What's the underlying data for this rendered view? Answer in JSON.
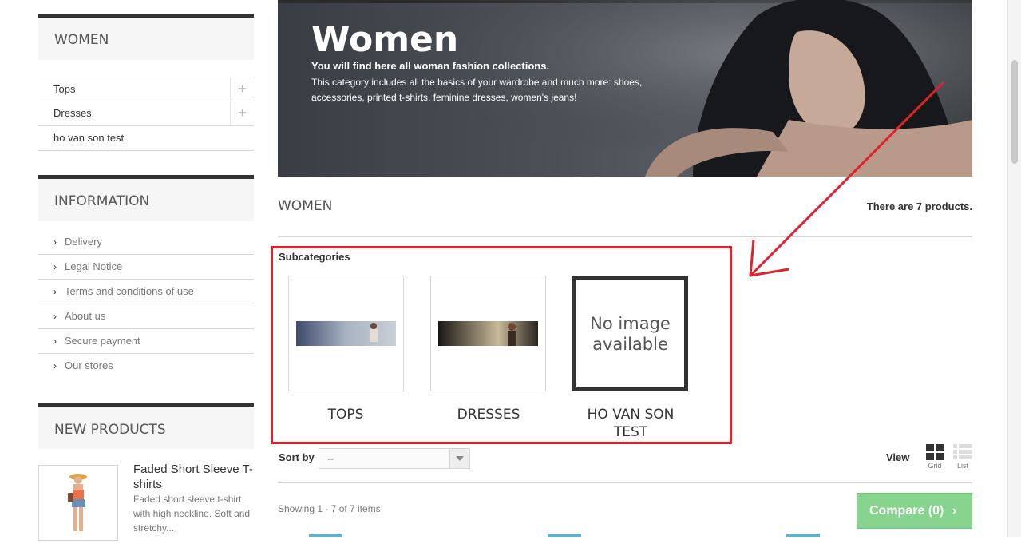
{
  "sidebar": {
    "categories": {
      "title": "WOMEN",
      "items": [
        {
          "label": "Tops",
          "expand": "+"
        },
        {
          "label": "Dresses",
          "expand": "+"
        },
        {
          "label": "ho van son test"
        }
      ]
    },
    "information": {
      "title": "INFORMATION",
      "items": [
        "Delivery",
        "Legal Notice",
        "Terms and conditions of use",
        "About us",
        "Secure payment",
        "Our stores"
      ]
    },
    "new_products": {
      "title": "NEW PRODUCTS",
      "product": {
        "name": "Faded Short Sleeve T-shirts",
        "description": "Faded short sleeve t-shirt with high neckline. Soft and stretchy..."
      }
    }
  },
  "banner": {
    "title": "Women",
    "subtitle": "You will find here all woman fashion collections.",
    "description": "This category includes all the basics of your wardrobe and much more: shoes, accessories, printed t-shirts, feminine dresses, women's jeans!"
  },
  "category": {
    "heading": "WOMEN",
    "count_text": "There are 7 products."
  },
  "subcategories": {
    "heading": "Subcategories",
    "items": [
      {
        "name": "TOPS"
      },
      {
        "name": "DRESSES"
      },
      {
        "name": "HO VAN SON TEST",
        "placeholder": "No image available"
      }
    ]
  },
  "sort": {
    "label": "Sort by",
    "selected": "--"
  },
  "view": {
    "label": "View",
    "grid_label": "Grid",
    "list_label": "List"
  },
  "showing_text": "Showing 1 - 7 of 7 items",
  "compare": {
    "label": "Compare (0)"
  },
  "colors": {
    "accent_dark": "#333333",
    "annotation_red": "#e0232b",
    "compare_green": "#86d48e"
  }
}
